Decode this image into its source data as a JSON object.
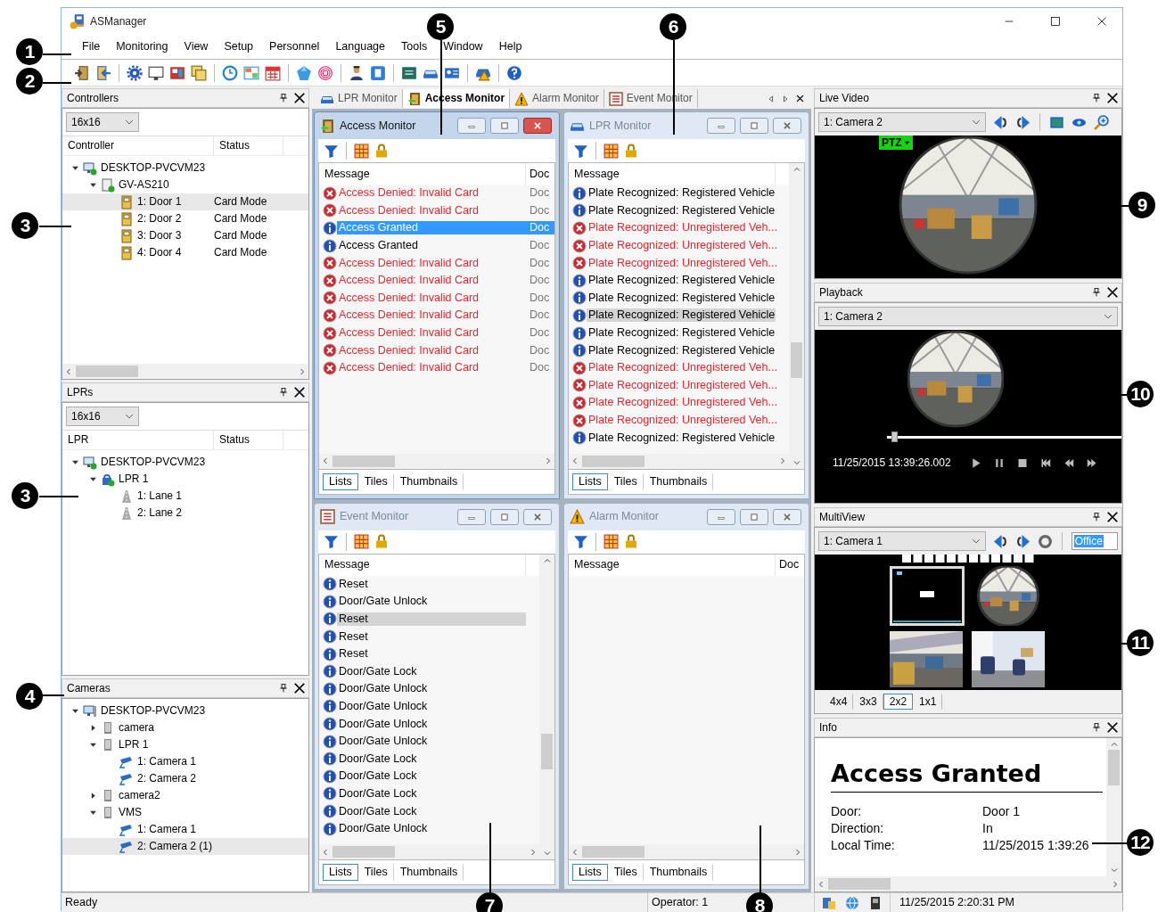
{
  "window": {
    "title": "ASManager"
  },
  "menu": [
    "File",
    "Monitoring",
    "View",
    "Setup",
    "Personnel",
    "Language",
    "Tools",
    "Window",
    "Help"
  ],
  "controllers": {
    "title": "Controllers",
    "size": "16x16",
    "columns": [
      "Controller",
      "Status"
    ],
    "tree": [
      {
        "label": "DESKTOP-PVCVM23",
        "kind": "computer",
        "expanded": true,
        "selected": false,
        "children": [
          {
            "label": "GV-AS210",
            "kind": "controller",
            "expanded": true,
            "selected": false,
            "children": [
              {
                "label": "1: Door 1",
                "kind": "door",
                "status": "Card Mode",
                "selected": true
              },
              {
                "label": "2: Door 2",
                "kind": "door",
                "status": "Card Mode",
                "selected": false
              },
              {
                "label": "3: Door 3",
                "kind": "door",
                "status": "Card Mode",
                "selected": false
              },
              {
                "label": "4: Door 4",
                "kind": "door",
                "status": "Card Mode",
                "selected": false
              }
            ]
          }
        ]
      }
    ]
  },
  "lprs": {
    "title": "LPRs",
    "size": "16x16",
    "columns": [
      "LPR",
      "Status"
    ],
    "tree": [
      {
        "label": "DESKTOP-PVCVM23",
        "kind": "computer",
        "expanded": true,
        "selected": false,
        "children": [
          {
            "label": "LPR 1",
            "kind": "lpr",
            "expanded": true,
            "selected": false,
            "children": [
              {
                "label": "1: Lane 1",
                "kind": "lane",
                "selected": false
              },
              {
                "label": "2: Lane 2",
                "kind": "lane",
                "selected": false
              }
            ]
          }
        ]
      }
    ]
  },
  "cameras": {
    "title": "Cameras",
    "tree": [
      {
        "label": "DESKTOP-PVCVM23",
        "kind": "workstation",
        "expanded": true,
        "selected": false,
        "children": [
          {
            "label": "camera",
            "kind": "server",
            "expanded": false,
            "selected": false
          },
          {
            "label": "LPR 1",
            "kind": "server",
            "expanded": true,
            "selected": false,
            "children": [
              {
                "label": "1: Camera 1",
                "kind": "camera",
                "selected": false
              },
              {
                "label": "2: Camera 2",
                "kind": "camera",
                "selected": false
              }
            ]
          },
          {
            "label": "camera2",
            "kind": "server",
            "expanded": false,
            "selected": false
          },
          {
            "label": "VMS",
            "kind": "server",
            "expanded": true,
            "selected": false,
            "children": [
              {
                "label": "1: Camera 1",
                "kind": "camera",
                "selected": false
              },
              {
                "label": "2: Camera 2 (1)",
                "kind": "camera",
                "selected": true
              }
            ]
          }
        ]
      }
    ]
  },
  "doc_tabs": [
    {
      "label": "LPR Monitor",
      "kind": "lpr",
      "selected": false
    },
    {
      "label": "Access Monitor",
      "kind": "access",
      "selected": true
    },
    {
      "label": "Alarm Monitor",
      "kind": "alarm",
      "selected": false
    },
    {
      "label": "Event Monitor",
      "kind": "event",
      "selected": false
    }
  ],
  "monitors": [
    {
      "title": "Access Monitor",
      "kind": "access",
      "active": true,
      "columns": [
        "Message",
        "Doc"
      ],
      "rows": [
        {
          "kind": "error",
          "message": "Access Denied: Invalid Card",
          "column_2": "Doc",
          "selected": false
        },
        {
          "kind": "error",
          "message": "Access Denied: Invalid Card",
          "column_2": "Doc",
          "selected": false
        },
        {
          "kind": "info",
          "message": "Access Granted",
          "column_2": "Doc",
          "selected": true
        },
        {
          "kind": "info",
          "message": "Access Granted",
          "column_2": "Doc",
          "selected": false
        },
        {
          "kind": "error",
          "message": "Access Denied: Invalid Card",
          "column_2": "Doc",
          "selected": false
        },
        {
          "kind": "error",
          "message": "Access Denied: Invalid Card",
          "column_2": "Doc",
          "selected": false
        },
        {
          "kind": "error",
          "message": "Access Denied: Invalid Card",
          "column_2": "Doc",
          "selected": false
        },
        {
          "kind": "error",
          "message": "Access Denied: Invalid Card",
          "column_2": "Doc",
          "selected": false
        },
        {
          "kind": "error",
          "message": "Access Denied: Invalid Card",
          "column_2": "Doc",
          "selected": false
        },
        {
          "kind": "error",
          "message": "Access Denied: Invalid Card",
          "column_2": "Doc",
          "selected": false
        },
        {
          "kind": "error",
          "message": "Access Denied: Invalid Card",
          "column_2": "Doc",
          "selected": false
        }
      ],
      "view_tabs": [
        {
          "label": "Lists",
          "selected": true
        },
        {
          "label": "Tiles",
          "selected": false
        },
        {
          "label": "Thumbnails",
          "selected": false
        }
      ]
    },
    {
      "title": "LPR Monitor",
      "kind": "lpr",
      "active": false,
      "columns": [
        "Message"
      ],
      "rows": [
        {
          "kind": "info",
          "message": "Plate Recognized: Registered Vehicle",
          "selected": false
        },
        {
          "kind": "info",
          "message": "Plate Recognized: Registered Vehicle",
          "selected": false
        },
        {
          "kind": "error",
          "message": "Plate Recognized: Unregistered Veh...",
          "selected": false
        },
        {
          "kind": "error",
          "message": "Plate Recognized: Unregistered Veh...",
          "selected": false
        },
        {
          "kind": "error",
          "message": "Plate Recognized: Unregistered Veh...",
          "selected": false
        },
        {
          "kind": "info",
          "message": "Plate Recognized: Registered Vehicle",
          "selected": false
        },
        {
          "kind": "info",
          "message": "Plate Recognized: Registered Vehicle",
          "selected": false
        },
        {
          "kind": "info",
          "message": "Plate Recognized: Registered Vehicle",
          "selected": true
        },
        {
          "kind": "info",
          "message": "Plate Recognized: Registered Vehicle",
          "selected": false
        },
        {
          "kind": "info",
          "message": "Plate Recognized: Registered Vehicle",
          "selected": false
        },
        {
          "kind": "error",
          "message": "Plate Recognized: Unregistered Veh...",
          "selected": false
        },
        {
          "kind": "error",
          "message": "Plate Recognized: Unregistered Veh...",
          "selected": false
        },
        {
          "kind": "error",
          "message": "Plate Recognized: Unregistered Veh...",
          "selected": false
        },
        {
          "kind": "error",
          "message": "Plate Recognized: Unregistered Veh...",
          "selected": false
        },
        {
          "kind": "info",
          "message": "Plate Recognized: Registered Vehicle",
          "selected": false
        }
      ],
      "view_tabs": [
        {
          "label": "Lists",
          "selected": true
        },
        {
          "label": "Tiles",
          "selected": false
        },
        {
          "label": "Thumbnails",
          "selected": false
        }
      ]
    },
    {
      "title": "Event Monitor",
      "kind": "event",
      "active": false,
      "columns": [
        "Message"
      ],
      "rows": [
        {
          "kind": "info",
          "message": "Reset",
          "selected": false
        },
        {
          "kind": "info",
          "message": "Door/Gate Unlock",
          "selected": false
        },
        {
          "kind": "info",
          "message": "Reset",
          "selected": true
        },
        {
          "kind": "info",
          "message": "Reset",
          "selected": false
        },
        {
          "kind": "info",
          "message": "Reset",
          "selected": false
        },
        {
          "kind": "info",
          "message": "Door/Gate Lock",
          "selected": false
        },
        {
          "kind": "info",
          "message": "Door/Gate Unlock",
          "selected": false
        },
        {
          "kind": "info",
          "message": "Door/Gate Unlock",
          "selected": false
        },
        {
          "kind": "info",
          "message": "Door/Gate Unlock",
          "selected": false
        },
        {
          "kind": "info",
          "message": "Door/Gate Unlock",
          "selected": false
        },
        {
          "kind": "info",
          "message": "Door/Gate Lock",
          "selected": false
        },
        {
          "kind": "info",
          "message": "Door/Gate Lock",
          "selected": false
        },
        {
          "kind": "info",
          "message": "Door/Gate Lock",
          "selected": false
        },
        {
          "kind": "info",
          "message": "Door/Gate Lock",
          "selected": false
        },
        {
          "kind": "info",
          "message": "Door/Gate Unlock",
          "selected": false
        }
      ],
      "view_tabs": [
        {
          "label": "Lists",
          "selected": true
        },
        {
          "label": "Tiles",
          "selected": false
        },
        {
          "label": "Thumbnails",
          "selected": false
        }
      ]
    },
    {
      "title": "Alarm Monitor",
      "kind": "alarm",
      "active": false,
      "columns": [
        "Message",
        "Doc"
      ],
      "view_tabs": [
        {
          "label": "Lists",
          "selected": true
        },
        {
          "label": "Tiles",
          "selected": false
        },
        {
          "label": "Thumbnails",
          "selected": false
        }
      ]
    }
  ],
  "live_video": {
    "title": "Live Video",
    "camera": "1: Camera 2",
    "overlay": "PTZ"
  },
  "playback": {
    "title": "Playback",
    "camera": "1: Camera 2",
    "level": 0.02,
    "timestamp": "11/25/2015 13:39:26.002"
  },
  "multiview": {
    "title": "MultiView",
    "camera": "1: Camera 1",
    "group": "Office",
    "layouts": [
      {
        "label": "4x4",
        "selected": false
      },
      {
        "label": "3x3",
        "selected": false
      },
      {
        "label": "2x2",
        "selected": true
      },
      {
        "label": "1x1",
        "selected": false
      }
    ]
  },
  "info": {
    "title": "Info",
    "heading": "Access Granted",
    "fields": [
      {
        "label": "Door:",
        "value": "Door 1"
      },
      {
        "label": "Direction:",
        "value": "In"
      },
      {
        "label": "Local Time:",
        "value": "11/25/2015 1:39:26"
      }
    ]
  },
  "status_bar": {
    "message": "Ready",
    "operator": "Operator: 1",
    "time": "11/25/2015 2:20:31 PM"
  },
  "callouts": [
    "1",
    "2",
    "3",
    "3",
    "4",
    "5",
    "6",
    "7",
    "8",
    "9",
    "10",
    "11",
    "12"
  ]
}
